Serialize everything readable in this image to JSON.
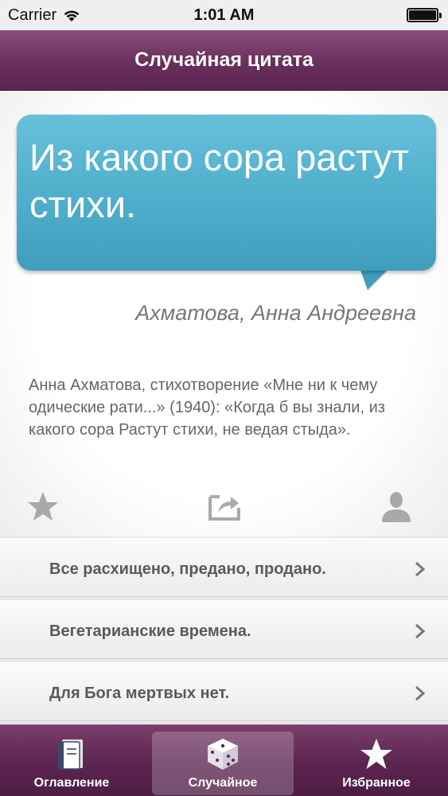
{
  "status_bar": {
    "carrier": "Carrier",
    "time": "1:01 AM"
  },
  "nav": {
    "title": "Случайная цитата"
  },
  "quote": {
    "text": "Из какого сора растут стихи.",
    "author": "Ахматова, Анна Андреевна",
    "description": "Анна Ахматова, стихотворение «Мне ни к чему одические рати...» (1940): «Когда б вы знали, из какого сора Растут стихи, не ведая стыда».",
    "bubble_color": "#4eaecb"
  },
  "actions": {
    "favorite_icon": "star-icon",
    "share_icon": "share-icon",
    "author_icon": "person-icon"
  },
  "related": [
    {
      "label": "Все расхищено, предано, продано."
    },
    {
      "label": "Вегетарианские времена."
    },
    {
      "label": "Для Бога мертвых нет."
    }
  ],
  "tabs": [
    {
      "label": "Оглавление",
      "icon": "book-icon"
    },
    {
      "label": "Случайное",
      "icon": "dice-icon",
      "selected": true
    },
    {
      "label": "Избранное",
      "icon": "star-icon"
    }
  ],
  "colors": {
    "nav_bar": "#6b2f5c",
    "tab_bar": "#5e2652"
  }
}
